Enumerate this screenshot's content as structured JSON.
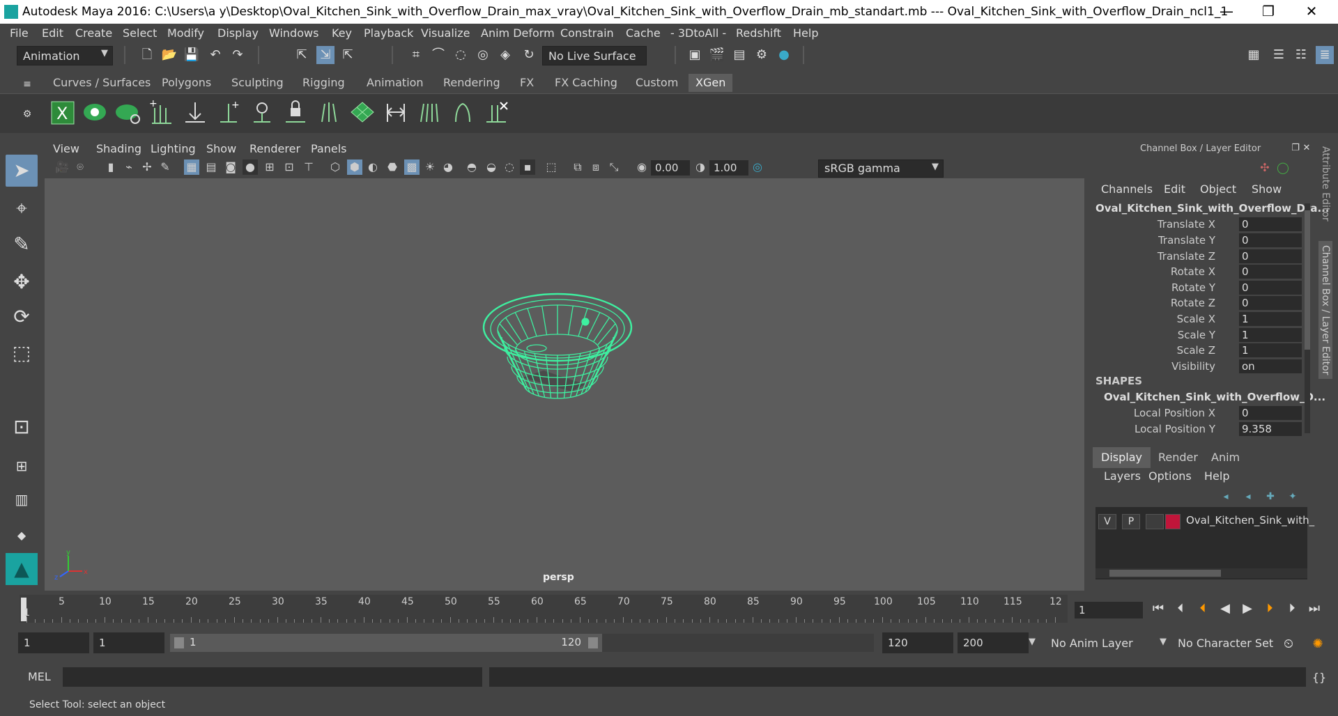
{
  "window": {
    "title": "Autodesk Maya 2016: C:\\Users\\a y\\Desktop\\Oval_Kitchen_Sink_with_Overflow_Drain_max_vray\\Oval_Kitchen_Sink_with_Overflow_Drain_mb_standart.mb   ---   Oval_Kitchen_Sink_with_Overflow_Drain_ncl1_1",
    "minimize": "—",
    "maximize": "❐",
    "close": "✕"
  },
  "menubar": [
    "File",
    "Edit",
    "Create",
    "Select",
    "Modify",
    "Display",
    "Windows",
    "Key",
    "Playback",
    "Visualize",
    "Anim Deform",
    "Constrain",
    "Cache",
    "- 3DtoAll -",
    "Redshift",
    "Help"
  ],
  "statusline": {
    "mode": "Animation",
    "live_surface": "No Live Surface"
  },
  "shelf": {
    "tabs": [
      "Curves / Surfaces",
      "Polygons",
      "Sculpting",
      "Rigging",
      "Animation",
      "Rendering",
      "FX",
      "FX Caching",
      "Custom",
      "XGen"
    ],
    "active_tab": "XGen"
  },
  "viewport": {
    "menu": [
      "View",
      "Shading",
      "Lighting",
      "Show",
      "Renderer",
      "Panels"
    ],
    "exposure": "0.00",
    "gamma": "1.00",
    "color_space": "sRGB gamma",
    "camera": "persp",
    "wire_color": "#3ef0a0"
  },
  "channelbox": {
    "title": "Channel Box / Layer Editor",
    "menu": [
      "Channels",
      "Edit",
      "Object",
      "Show"
    ],
    "object_name": "Oval_Kitchen_Sink_with_Overflow_Dra...",
    "attributes": [
      {
        "name": "Translate X",
        "value": "0"
      },
      {
        "name": "Translate Y",
        "value": "0"
      },
      {
        "name": "Translate Z",
        "value": "0"
      },
      {
        "name": "Rotate X",
        "value": "0"
      },
      {
        "name": "Rotate Y",
        "value": "0"
      },
      {
        "name": "Rotate Z",
        "value": "0"
      },
      {
        "name": "Scale X",
        "value": "1"
      },
      {
        "name": "Scale Y",
        "value": "1"
      },
      {
        "name": "Scale Z",
        "value": "1"
      },
      {
        "name": "Visibility",
        "value": "on"
      }
    ],
    "shapes_label": "SHAPES",
    "shape_name": "Oval_Kitchen_Sink_with_Overflow_D...",
    "shape_attributes": [
      {
        "name": "Local Position X",
        "value": "0"
      },
      {
        "name": "Local Position Y",
        "value": "9.358"
      }
    ],
    "side_tabs": [
      "Attribute Editor",
      "Channel Box / Layer Editor"
    ]
  },
  "layer_editor": {
    "tabs": [
      "Display",
      "Render",
      "Anim"
    ],
    "active_tab": "Display",
    "menu": [
      "Layers",
      "Options",
      "Help"
    ],
    "layer": {
      "v": "V",
      "p": "P",
      "name": "Oval_Kitchen_Sink_with_",
      "color": "#c0153a"
    }
  },
  "timeslider": {
    "ticks": [
      "1",
      "5",
      "10",
      "15",
      "20",
      "25",
      "30",
      "35",
      "40",
      "45",
      "50",
      "55",
      "60",
      "65",
      "70",
      "75",
      "80",
      "85",
      "90",
      "95",
      "100",
      "105",
      "110",
      "115",
      "12"
    ],
    "current_frame": "1"
  },
  "range": {
    "start": "1",
    "playback_start": "1",
    "range_start": "1",
    "range_end": "120",
    "playback_end": "120",
    "end": "200",
    "anim_layer": "No Anim Layer",
    "char_set": "No Character Set"
  },
  "cmdline": {
    "label": "MEL"
  },
  "helpline": {
    "text": "Select Tool: select an object"
  }
}
